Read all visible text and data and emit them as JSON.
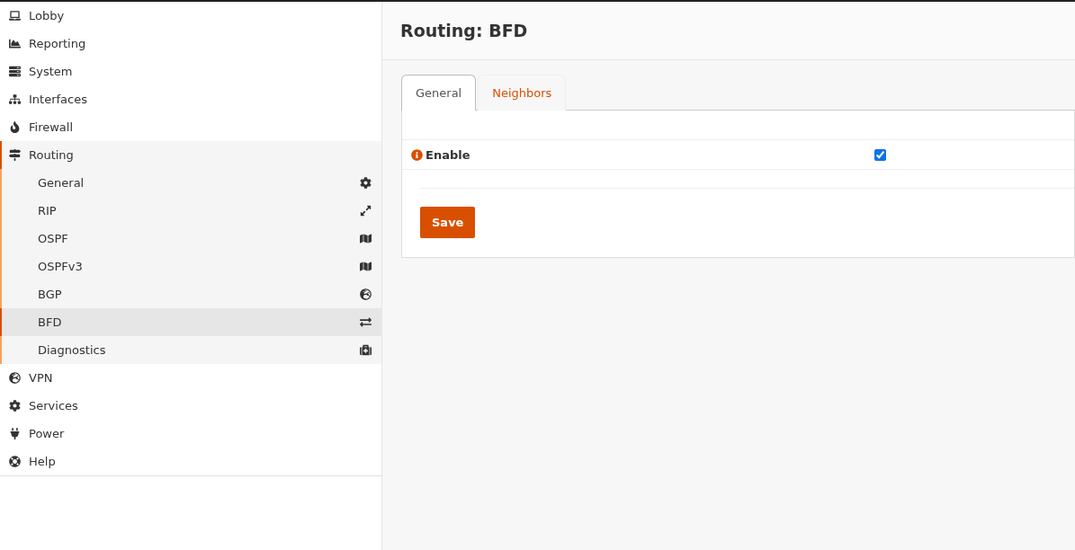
{
  "sidebar": {
    "items": [
      {
        "label": "Lobby",
        "expanded": false
      },
      {
        "label": "Reporting",
        "expanded": false
      },
      {
        "label": "System",
        "expanded": false
      },
      {
        "label": "Interfaces",
        "expanded": false
      },
      {
        "label": "Firewall",
        "expanded": false
      },
      {
        "label": "Routing",
        "expanded": true,
        "children": [
          {
            "label": "General",
            "selected": false
          },
          {
            "label": "RIP",
            "selected": false
          },
          {
            "label": "OSPF",
            "selected": false
          },
          {
            "label": "OSPFv3",
            "selected": false
          },
          {
            "label": "BGP",
            "selected": false
          },
          {
            "label": "BFD",
            "selected": true
          },
          {
            "label": "Diagnostics",
            "selected": false
          }
        ]
      },
      {
        "label": "VPN",
        "expanded": false
      },
      {
        "label": "Services",
        "expanded": false
      },
      {
        "label": "Power",
        "expanded": false
      },
      {
        "label": "Help",
        "expanded": false
      }
    ]
  },
  "page": {
    "title": "Routing: BFD"
  },
  "tabs": [
    {
      "label": "General",
      "selected": true
    },
    {
      "label": "Neighbors",
      "selected": false
    }
  ],
  "form": {
    "fields": [
      {
        "label": "Enable",
        "checked": true
      }
    ],
    "save_button": "Save"
  }
}
